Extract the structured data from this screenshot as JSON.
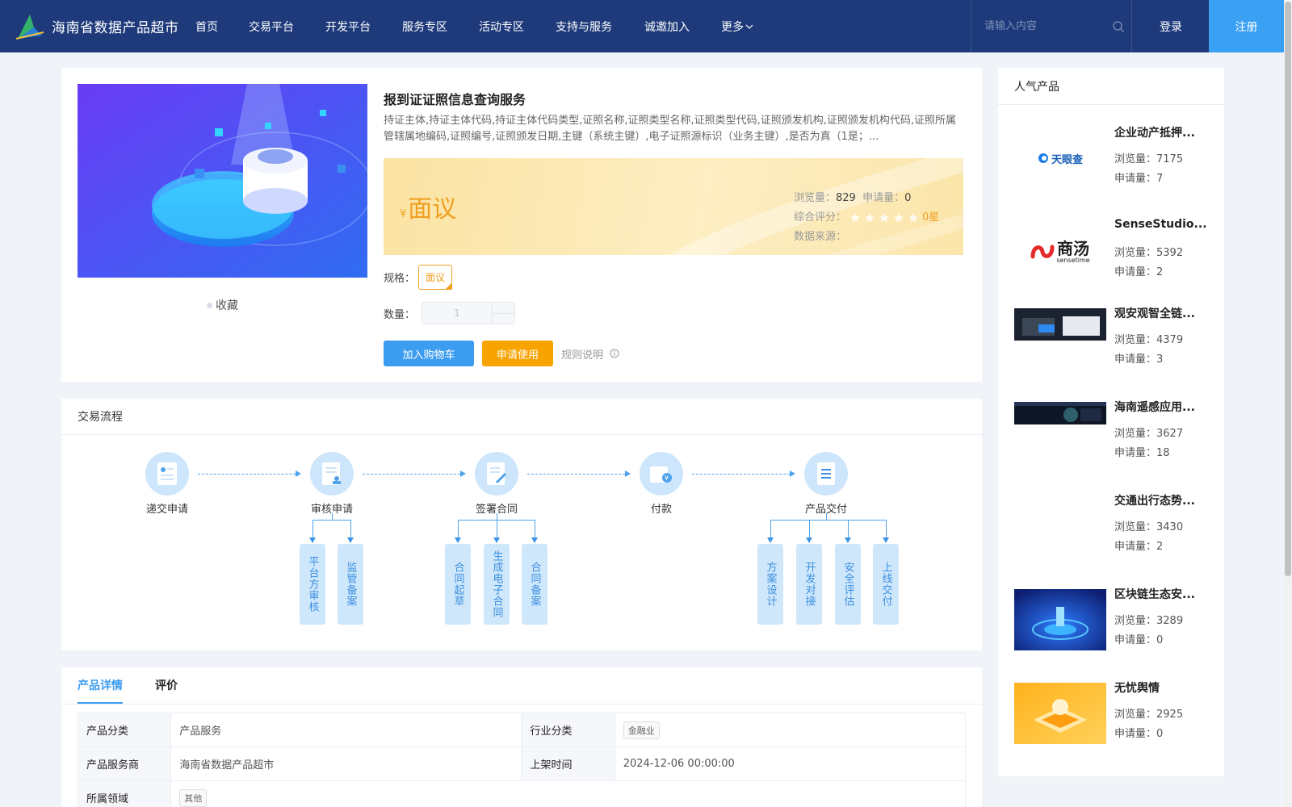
{
  "header": {
    "site_name": "海南省数据产品超市",
    "nav": [
      {
        "label": "首页",
        "key": "home"
      },
      {
        "label": "交易平台",
        "key": "trade"
      },
      {
        "label": "开发平台",
        "key": "dev"
      },
      {
        "label": "服务专区",
        "key": "service"
      },
      {
        "label": "活动专区",
        "key": "activity"
      },
      {
        "label": "支持与服务",
        "key": "support"
      },
      {
        "label": "诚邀加入",
        "key": "join"
      },
      {
        "label": "更多",
        "key": "more"
      }
    ],
    "search_placeholder": "请输入内容",
    "login": "登录",
    "register": "注册"
  },
  "product": {
    "title": "报到证证照信息查询服务",
    "description": "持证主体,持证主体代码,持证主体代码类型,证照名称,证照类型名称,证照类型代码,证照颁发机构,证照颁发机构代码,证照所属管辖属地编码,证照编号,证照颁发日期,主键（系统主键）,电子证照源标识（业务主键）,是否为真（1是；...",
    "price_symbol": "¥",
    "price": "面议",
    "views_label": "浏览量：",
    "views": "829",
    "applies_label": "申请量：",
    "applies": "0",
    "rating_label": "综合评分：",
    "rating": "0星",
    "source_label": "数据来源：",
    "source": "",
    "spec_label": "规格：",
    "spec": "面议",
    "qty_label": "数量：",
    "qty": "1",
    "favorite": "收藏",
    "add_cart": "加入购物车",
    "apply": "申请使用",
    "rules": "规则说明"
  },
  "process": {
    "title": "交易流程",
    "steps": [
      "递交申请",
      "审核申请",
      "签署合同",
      "付款",
      "产品交付"
    ],
    "subs": {
      "review": [
        "平台方审核",
        "监管备案"
      ],
      "contract": [
        "合同起草",
        "生成电子合同",
        "合同备案"
      ],
      "deliver": [
        "方案设计",
        "开发对接",
        "安全评估",
        "上线交付"
      ]
    }
  },
  "details": {
    "tabs": [
      "产品详情",
      "评价"
    ],
    "rows": [
      {
        "k1": "产品分类",
        "v1": "产品服务",
        "k2": "行业分类",
        "v2": "金融业"
      },
      {
        "k1": "产品服务商",
        "v1": "海南省数据产品超市",
        "k2": "上架时间",
        "v2": "2024-12-06 00:00:00"
      },
      {
        "k1": "所属领域",
        "v1": "其他"
      }
    ]
  },
  "popular": {
    "title": "人气产品",
    "views_label": "浏览量：",
    "applies_label": "申请量：",
    "items": [
      {
        "name": "企业动产抵押...",
        "views": "7175",
        "applies": "7",
        "thumb": "tianyancha-logo"
      },
      {
        "name": "SenseStudio...",
        "views": "5392",
        "applies": "2",
        "thumb": "sensetime-logo"
      },
      {
        "name": "观安观智全链...",
        "views": "4379",
        "applies": "3",
        "thumb": "screenshot-dark"
      },
      {
        "name": "海南遥感应用...",
        "views": "3627",
        "applies": "18",
        "thumb": "screenshot-dark2"
      },
      {
        "name": "交通出行态势...",
        "views": "3430",
        "applies": "2",
        "thumb": "blank"
      },
      {
        "name": "区块链生态安...",
        "views": "3289",
        "applies": "0",
        "thumb": "blockchain-art"
      },
      {
        "name": "无忧舆情",
        "views": "2925",
        "applies": "0",
        "thumb": "orange-art"
      }
    ],
    "logo_text_tianyancha": "天眼查",
    "logo_text_sensetime": "商汤",
    "logo_sub_sensetime": "sensetime"
  },
  "colors": {
    "header_bg": "#1e3a7b",
    "accent_blue": "#3c9cf0",
    "accent_orange": "#f7a400"
  }
}
